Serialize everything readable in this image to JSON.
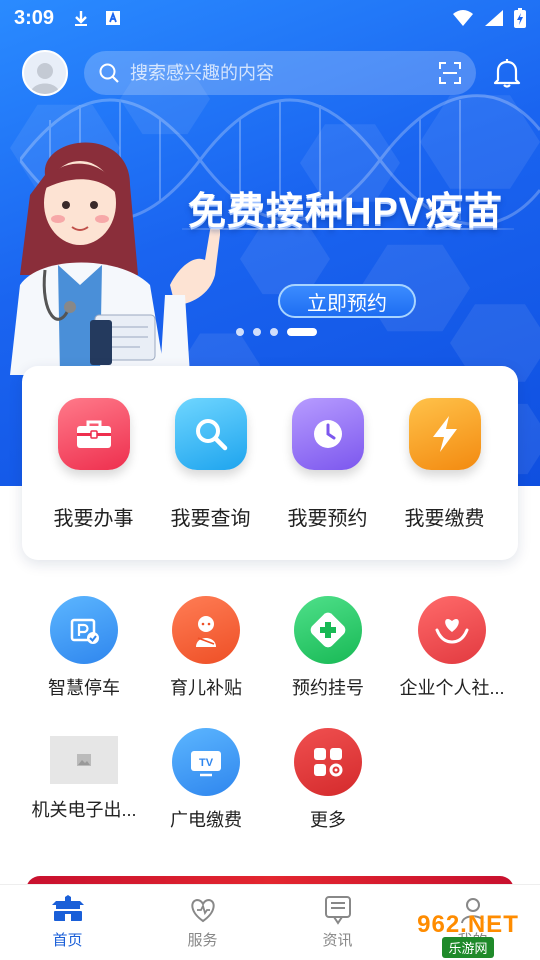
{
  "status_bar": {
    "time": "3:09"
  },
  "search": {
    "placeholder": "搜索感兴趣的内容"
  },
  "banner": {
    "title": "免费接种HPV疫苗",
    "cta_label": "立即预约",
    "slide_count": 4,
    "active_slide": 4
  },
  "quick_actions": [
    {
      "label": "我要办事",
      "icon": "briefcase-icon",
      "color": "#f0405a"
    },
    {
      "label": "我要查询",
      "icon": "search-icon",
      "color": "#2bb1f0"
    },
    {
      "label": "我要预约",
      "icon": "clock-icon",
      "color": "#8f6cf0"
    },
    {
      "label": "我要缴费",
      "icon": "lightning-icon",
      "color": "#f39a1a"
    }
  ],
  "services": [
    {
      "label": "智慧停车",
      "icon": "parking-icon",
      "color": "#3d9bf2"
    },
    {
      "label": "育儿补贴",
      "icon": "baby-icon",
      "color": "#f2603a"
    },
    {
      "label": "预约挂号",
      "icon": "medical-cross-icon",
      "color": "#2fc86a"
    },
    {
      "label": "企业个人社...",
      "icon": "heart-hands-icon",
      "color": "#ef4a4f"
    },
    {
      "label": "机关电子出...",
      "icon": "image-placeholder-icon",
      "color": "#e6e6e6"
    },
    {
      "label": "广电缴费",
      "icon": "tv-icon",
      "color": "#3d9bf2"
    },
    {
      "label": "更多",
      "icon": "grid-more-icon",
      "color": "#e0383a"
    }
  ],
  "bottom_nav": [
    {
      "label": "首页",
      "icon": "home-icon",
      "active": true
    },
    {
      "label": "服务",
      "icon": "heart-icon",
      "active": false
    },
    {
      "label": "资讯",
      "icon": "news-icon",
      "active": false
    },
    {
      "label": "我的",
      "icon": "user-icon",
      "active": false
    }
  ],
  "watermark": {
    "brand": "962.NET",
    "sub": "乐游网"
  }
}
